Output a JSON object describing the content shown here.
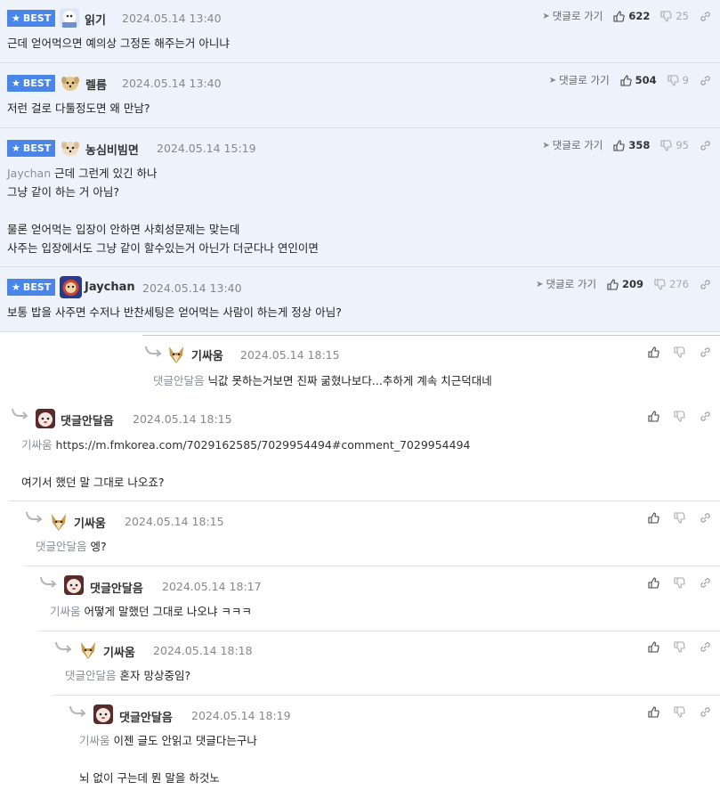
{
  "best_comments": [
    {
      "badge": "BEST",
      "nick": "읽기",
      "date": "2024.05.14 13:40",
      "goto": "댓글로 가기",
      "up": "622",
      "down": "25",
      "lines": [
        "근데 얻어먹으면 예의상 그정돈 해주는거 아니냐"
      ]
    },
    {
      "badge": "BEST",
      "nick": "렐름",
      "date": "2024.05.14 13:40",
      "goto": "댓글로 가기",
      "up": "504",
      "down": "9",
      "lines": [
        "저런 걸로 다툴정도면 왜 만남?"
      ]
    },
    {
      "badge": "BEST",
      "nick": "농심비빔면",
      "date": "2024.05.14 15:19",
      "goto": "댓글로 가기",
      "up": "358",
      "down": "95",
      "mention": "Jaychan",
      "lines": [
        "근데 그런게 있긴 하나",
        "그냥 같이 하는 거 아님?",
        "",
        "물론 얻어먹는 입장이 안하면 사회성문제는 맞는데",
        "사주는 입장에서도 그냥 같이 할수있는거 아닌가 더군다나 연인이면"
      ]
    },
    {
      "badge": "BEST",
      "nick": "Jaychan",
      "date": "2024.05.14 13:40",
      "goto": "댓글로 가기",
      "up": "209",
      "down": "276",
      "lines": [
        "보통 밥을 사주면 수저나 반찬세팅은 얻어먹는 사람이 하는게 정상 아님?"
      ]
    }
  ],
  "replies": [
    {
      "nick": "기싸움",
      "date": "2024.05.14 18:15",
      "mention": "댓글안달음",
      "lines": [
        "닉값 못하는거보면 진짜 굶혔나보다...추하게 계속 치근덕대네"
      ]
    },
    {
      "nick": "댓글안달음",
      "date": "2024.05.14 18:15",
      "mention": "기싸움",
      "lines": [
        "https://m.fmkorea.com/7029162585/7029954494#comment_7029954494",
        "",
        "여기서 했던 말 그대로 나오죠?"
      ]
    },
    {
      "nick": "기싸움",
      "date": "2024.05.14 18:15",
      "mention": "댓글안달음",
      "lines": [
        "엥?"
      ]
    },
    {
      "nick": "댓글안달음",
      "date": "2024.05.14 18:17",
      "mention": "기싸움",
      "lines": [
        "어떻게 말했던 그대로 나오냐 ㅋㅋㅋ"
      ]
    },
    {
      "nick": "기싸움",
      "date": "2024.05.14 18:18",
      "mention": "댓글안달음",
      "lines": [
        "혼자 망상중임?"
      ]
    },
    {
      "nick": "댓글안달음",
      "date": "2024.05.14 18:19",
      "mention": "기싸움",
      "lines": [
        "이젠 글도 안읽고 댓글다는구나",
        "",
        "뇌 없이 구는데 뭔 말을 하것노"
      ]
    }
  ],
  "colors": {
    "best_bg": "#eef2fb",
    "badge": "#4a86e8",
    "mention": "#8a8f98"
  }
}
